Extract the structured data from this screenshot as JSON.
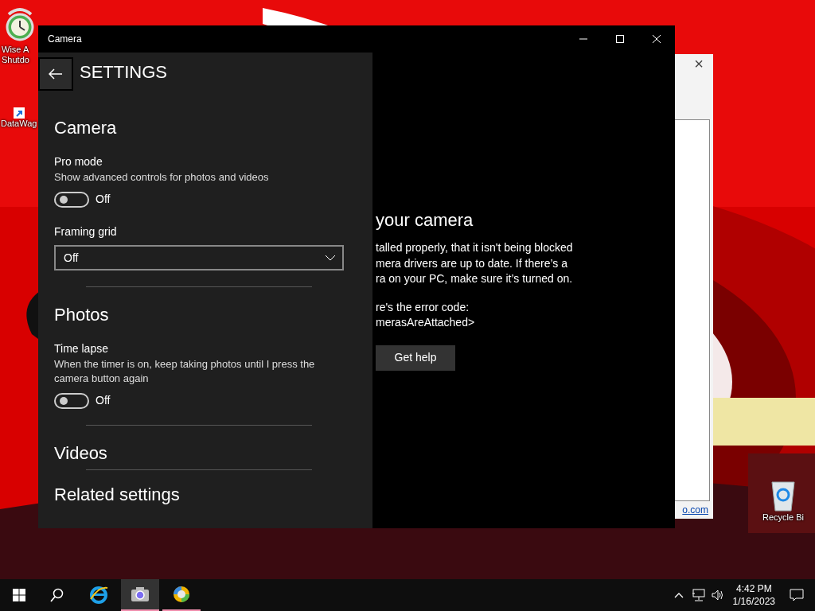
{
  "desktop_icons": [
    {
      "kind": "clock",
      "lines": [
        "Wise A",
        "Shutdo"
      ]
    },
    {
      "kind": "shortcut",
      "lines": [
        "DataWag"
      ]
    },
    {
      "kind": "recycle",
      "lines": [
        "Recycle Bi"
      ]
    }
  ],
  "background_dialog": {
    "close": "×",
    "link": "o.com"
  },
  "window": {
    "title": "Camera"
  },
  "settings": {
    "title": "SETTINGS",
    "sections": [
      {
        "heading": "Camera",
        "items": [
          {
            "kind": "toggle",
            "label": "Pro mode",
            "description": "Show advanced controls for photos and videos",
            "on": false,
            "state_text": "Off"
          },
          {
            "kind": "dropdown",
            "label": "Framing grid",
            "value": "Off"
          }
        ]
      },
      {
        "heading": "Photos",
        "items": [
          {
            "kind": "toggle",
            "label": "Time lapse",
            "description": "When the timer is on, keep taking photos until I press the camera button again",
            "on": false,
            "state_text": "Off"
          }
        ]
      },
      {
        "heading": "Videos"
      },
      {
        "heading": "Related settings"
      }
    ]
  },
  "error": {
    "title": "your camera",
    "lines": [
      "talled properly, that it isn't being blocked",
      "mera drivers are up to date. If there’s a",
      "ra on your PC, make sure it’s turned on."
    ],
    "code_lines": [
      "re's the error code:",
      "merasAreAttached>"
    ],
    "button": "Get help"
  },
  "taskbar": {
    "apps": [
      {
        "kind": "browser",
        "running": false,
        "selected": false
      },
      {
        "kind": "camera",
        "running": true,
        "selected": true
      },
      {
        "kind": "orb",
        "running": true,
        "selected": false
      }
    ],
    "time": "4:42 PM",
    "date": "1/16/2023"
  }
}
